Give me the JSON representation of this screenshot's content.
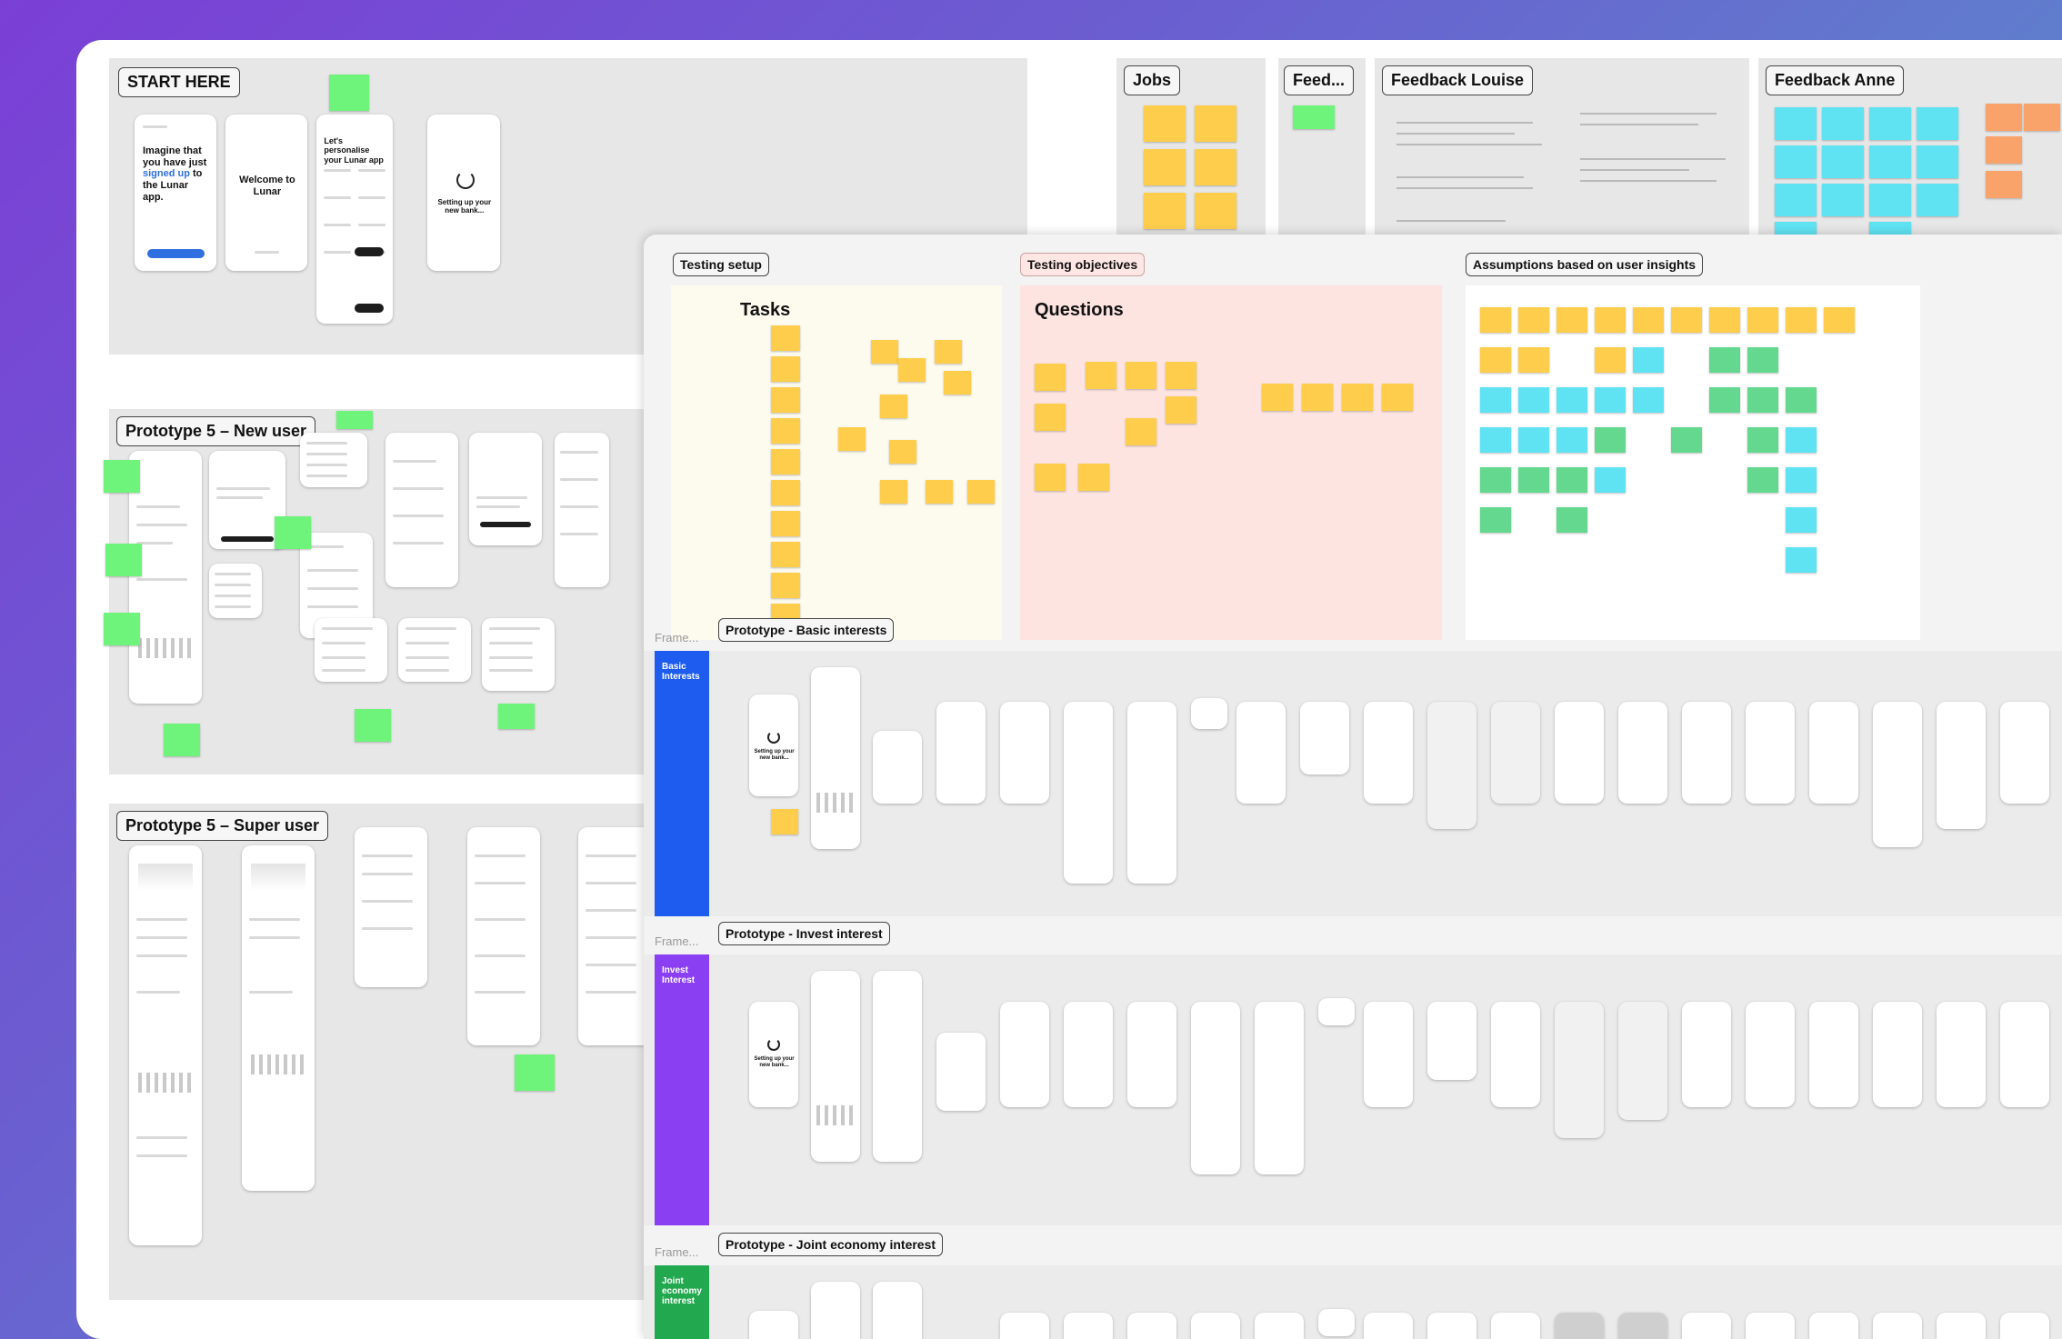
{
  "board_top": {
    "start_here": {
      "label": "START HERE",
      "screen_1_text": "Imagine that you have just",
      "screen_1_link": "signed up",
      "screen_1_text_end": "to the Lunar app.",
      "screen_2_text": "Welcome to Lunar",
      "screen_3_text": "Let's personalise your Lunar app",
      "screen_4_text": "Setting up your new bank..."
    },
    "jobs_label": "Jobs",
    "feed_label": "Feed...",
    "feedback_louise_label": "Feedback Louise",
    "feedback_anne_label": "Feedback Anne",
    "prototype_new_user_label": "Prototype 5 – New user",
    "prototype_super_user_label": "Prototype 5 – Super user"
  },
  "board_bottom": {
    "testing_setup_label": "Testing setup",
    "testing_objectives_label": "Testing objectives",
    "assumptions_label": "Assumptions based on user insights",
    "tasks_title": "Tasks",
    "questions_title": "Questions",
    "frame_tag": "Frame...",
    "basic_interests": {
      "label": "Prototype - Basic interests",
      "strip_text": "Basic Interests",
      "strip_color": "#1e5cf0",
      "spinner_text": "Setting up your new bank..."
    },
    "invest_interest": {
      "label": "Prototype - Invest interest",
      "strip_text": "Invest Interest",
      "strip_color": "#8b3ff2",
      "spinner_text": "Setting up your new bank..."
    },
    "joint_economy": {
      "label": "Prototype - Joint economy interest",
      "strip_text": "Joint economy interest",
      "strip_color": "#22a84e"
    }
  },
  "colors": {
    "sticky_yellow": "#fecd4c",
    "sticky_green": "#6ef37b",
    "sticky_cyan": "#5fe3f2",
    "sticky_orange": "#f9a36a",
    "tasks_panel_bg": "#fdfaee",
    "questions_panel_bg": "#fde4e1"
  }
}
